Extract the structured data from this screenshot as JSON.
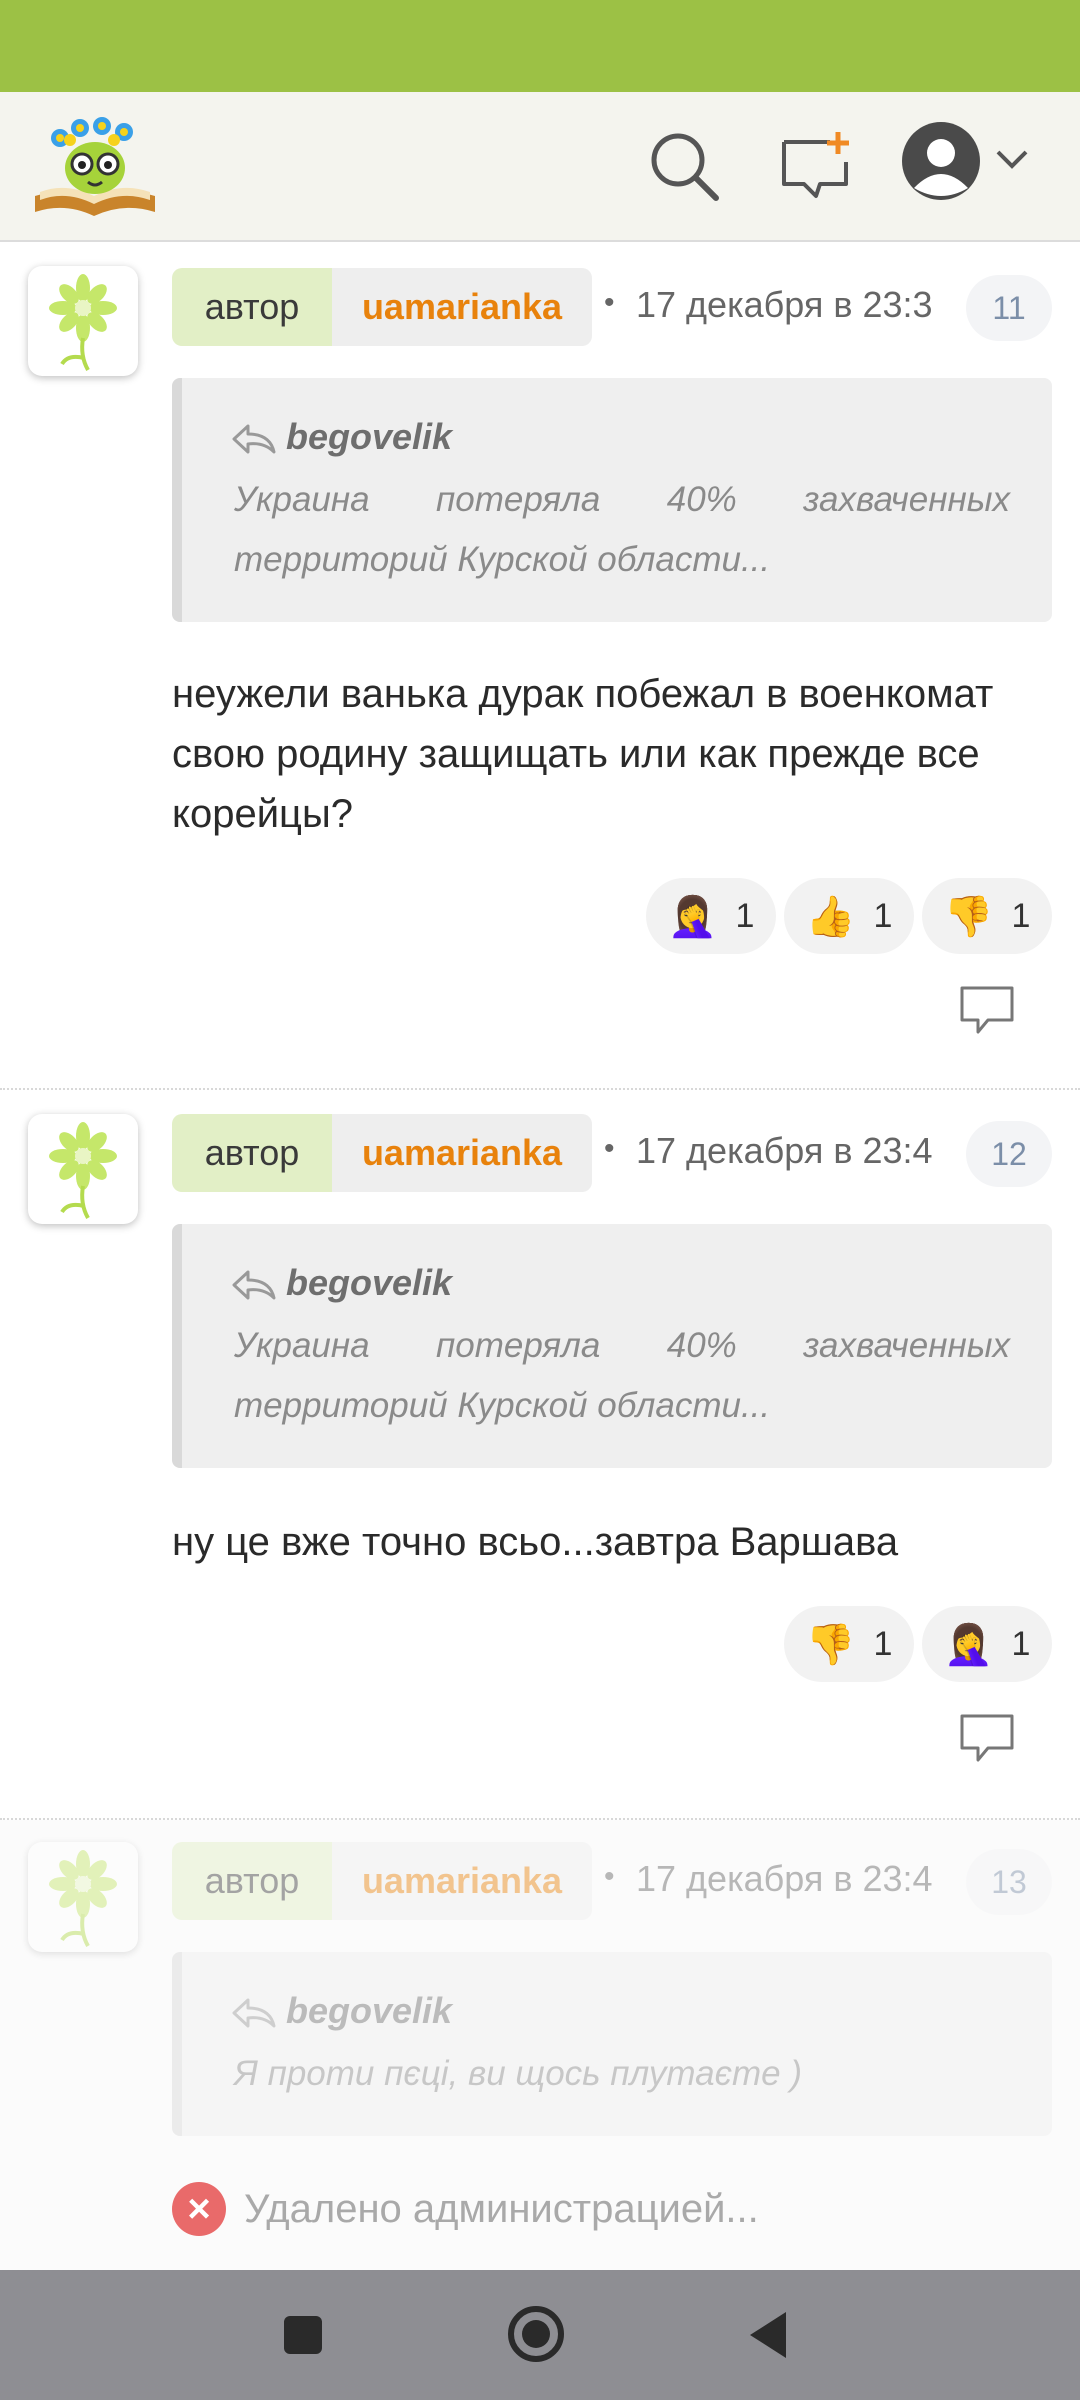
{
  "header": {
    "logo": "site-logo",
    "icons": [
      "search-icon",
      "new-message-icon",
      "profile-icon",
      "chevron-down-icon"
    ]
  },
  "comments": [
    {
      "author_tag": "автор",
      "author_name": "uamarianka",
      "separator": "•",
      "date": "17 декабря в 23:3",
      "number": "11",
      "quote": {
        "user": "begovelik",
        "text_line1": "Украина потеряла 40% захваченных",
        "text_line2": "территорий Курской области..."
      },
      "body": "неужели ванька дурак побежал в военкомат свою родину защищать или как прежде все корейцы?",
      "reactions": [
        {
          "emoji": "🤦‍♀️",
          "count": "1"
        },
        {
          "emoji": "👍",
          "count": "1"
        },
        {
          "emoji": "👎",
          "count": "1"
        }
      ]
    },
    {
      "author_tag": "автор",
      "author_name": "uamarianka",
      "separator": "•",
      "date": "17 декабря в 23:4",
      "number": "12",
      "quote": {
        "user": "begovelik",
        "text_line1": "Украина потеряла 40% захваченных",
        "text_line2": "территорий Курской области..."
      },
      "body": "ну це вже точно всьо...завтра Варшава",
      "reactions": [
        {
          "emoji": "👎",
          "count": "1"
        },
        {
          "emoji": "🤦‍♀️",
          "count": "1"
        }
      ]
    },
    {
      "author_tag": "автор",
      "author_name": "uamarianka",
      "separator": "•",
      "date": "17 декабря в 23:4",
      "number": "13",
      "quote": {
        "user": "begovelik",
        "text_line1": "Я проти пєці, ви щось плутаєте )"
      },
      "deleted_text": "Удалено администрацией..."
    }
  ],
  "colors": {
    "status_bar": "#9cc145",
    "header_bg": "#f4f4ee",
    "author_tag_bg": "#e2efc6",
    "author_name": "#e8820c",
    "quote_bg": "#efefef",
    "deleted_icon": "#e96a6a",
    "nav_bar": "#8e8e93"
  },
  "navbar": {
    "icons": [
      "recents-square-icon",
      "home-circle-icon",
      "back-triangle-icon"
    ]
  }
}
